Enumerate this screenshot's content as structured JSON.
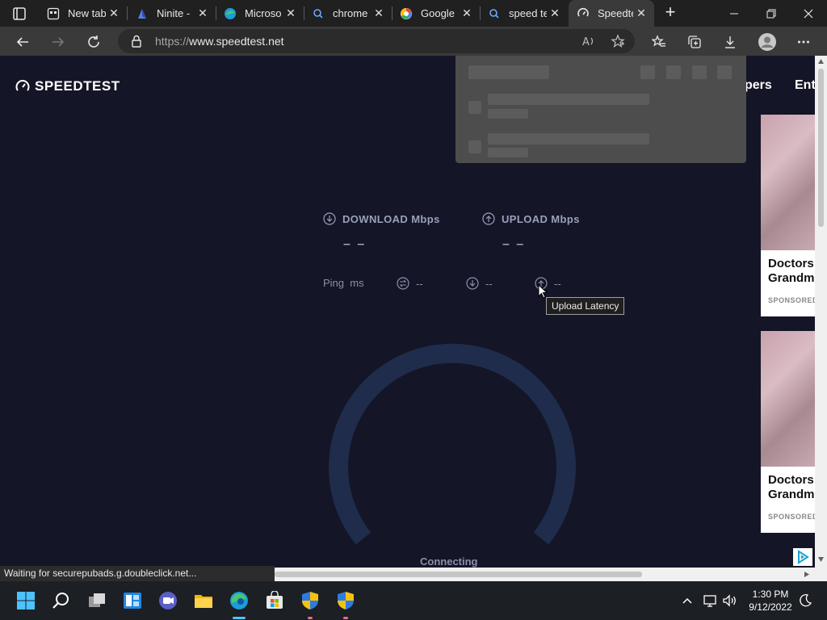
{
  "tabs": [
    {
      "title": "New tab",
      "icon": "newtab-icon"
    },
    {
      "title": "Ninite -",
      "icon": "ninite-icon"
    },
    {
      "title": "Microso",
      "icon": "edge-icon"
    },
    {
      "title": "chrome",
      "icon": "search-icon"
    },
    {
      "title": "Google",
      "icon": "google-icon"
    },
    {
      "title": "speed te",
      "icon": "search-icon"
    },
    {
      "title": "Speedte",
      "icon": "speedtest-icon",
      "active": true
    }
  ],
  "address_bar": {
    "protocol": "https://",
    "domain": "www.speedtest.net"
  },
  "page": {
    "logo_text": "SPEEDTEST",
    "nav_partial_1": "pers",
    "nav_partial_2": "Ent",
    "download_label": "DOWNLOAD Mbps",
    "upload_label": "UPLOAD Mbps",
    "download_value": "– –",
    "upload_value": "– –",
    "ping_label": "Ping",
    "ping_unit": "ms",
    "jitter_value": "--",
    "download_latency_value": "--",
    "upload_latency_value": "--",
    "tooltip": "Upload Latency",
    "status": "Connecting"
  },
  "ads": [
    {
      "headline_1": "Doctors",
      "headline_2": "Grandm",
      "label": "SPONSORED"
    },
    {
      "headline_1": "Doctors",
      "headline_2": "Grandm",
      "label": "SPONSORED"
    }
  ],
  "status_bar": "Waiting for securepubads.g.doubleclick.net...",
  "taskbar": {
    "time": "1:30 PM",
    "date": "9/12/2022"
  },
  "colors": {
    "page_bg": "#141526",
    "gauge": "#1f2c4c",
    "text_muted": "#9aa1bd",
    "dropdown": "#4d4d4d"
  }
}
